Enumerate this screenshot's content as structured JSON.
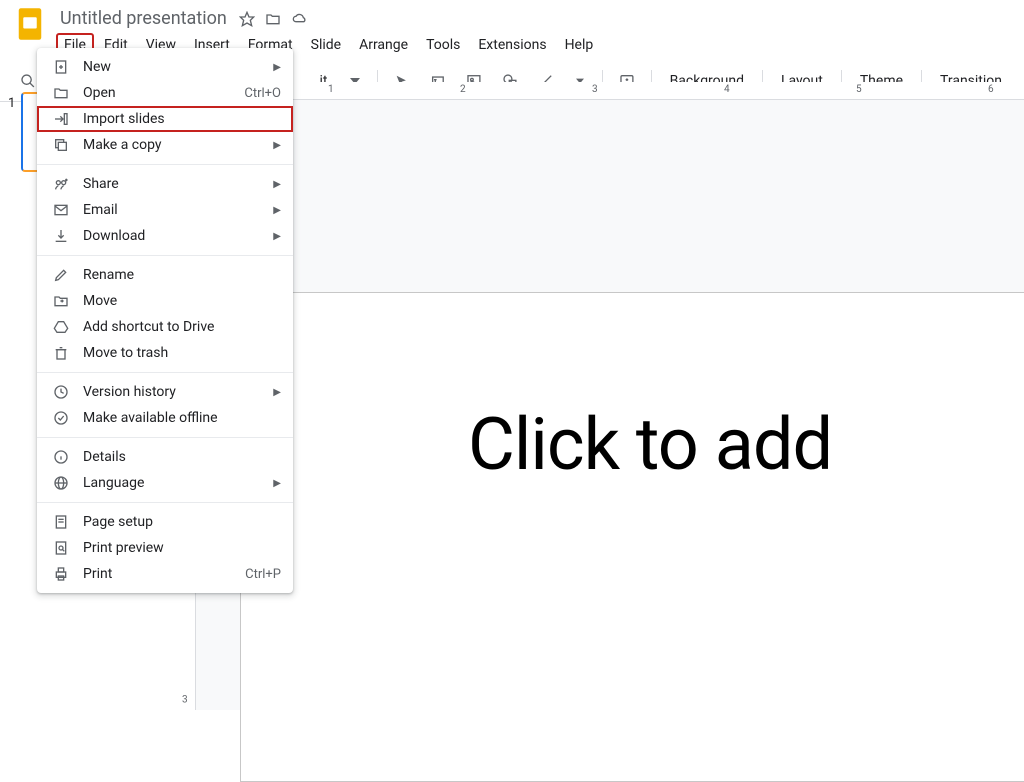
{
  "header": {
    "title": "Untitled presentation"
  },
  "menubar": [
    "File",
    "Edit",
    "View",
    "Insert",
    "Format",
    "Slide",
    "Arrange",
    "Tools",
    "Extensions",
    "Help"
  ],
  "toolbar_visible_text": "it",
  "toolbar_right": {
    "background": "Background",
    "layout": "Layout",
    "theme": "Theme",
    "transition": "Transition"
  },
  "file_menu": {
    "new": "New",
    "open": {
      "label": "Open",
      "shortcut": "Ctrl+O"
    },
    "import_slides": "Import slides",
    "make_copy": "Make a copy",
    "share": "Share",
    "email": "Email",
    "download": "Download",
    "rename": "Rename",
    "move": "Move",
    "add_shortcut": "Add shortcut to Drive",
    "move_to_trash": "Move to trash",
    "version_history": "Version history",
    "offline": "Make available offline",
    "details": "Details",
    "language": "Language",
    "page_setup": "Page setup",
    "print_preview": "Print preview",
    "print": {
      "label": "Print",
      "shortcut": "Ctrl+P"
    }
  },
  "sidebar": {
    "slide_number": "1"
  },
  "ruler_h": [
    "1",
    "2",
    "3",
    "4",
    "5",
    "6"
  ],
  "ruler_v": [
    "3"
  ],
  "canvas": {
    "placeholder": "Click to add"
  }
}
